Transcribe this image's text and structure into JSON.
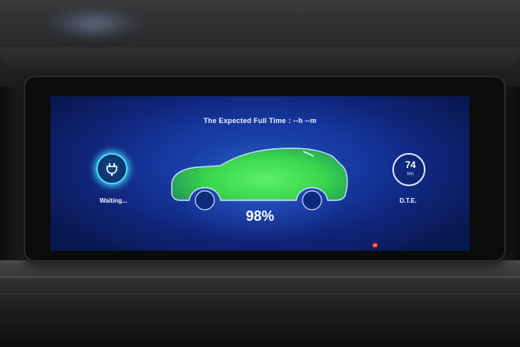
{
  "display": {
    "expected_full_time_label": "The Expected Full Time",
    "separator": ":",
    "expected_full_time_value": "--h --m",
    "charging_status": "Waiting...",
    "battery_percent": "98%",
    "battery_fill_fraction": 0.98,
    "range_value": "74",
    "range_unit": "km",
    "range_label": "D.T.E.",
    "icons": {
      "charge": "charging-plug-icon",
      "vehicle": "car-silhouette-icon",
      "warning": "warning-indicator-icon"
    }
  },
  "colors": {
    "screen_bg": "#1638a0",
    "charge_fill": "#4fe05a",
    "ring_glow": "#49e6ff",
    "text": "#eef3ff",
    "warning": "#e52020"
  }
}
